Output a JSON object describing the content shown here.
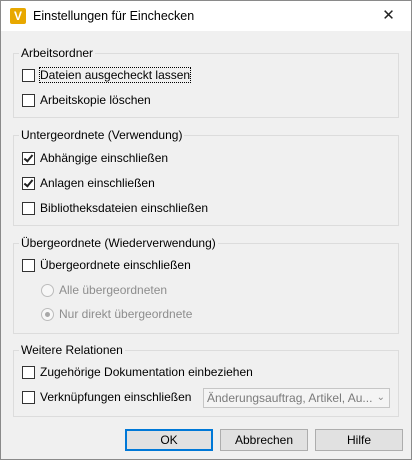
{
  "window": {
    "title": "Einstellungen für Einchecken",
    "icon_letter": "V",
    "close_glyph": "✕"
  },
  "groups": {
    "work_folder": {
      "title": "Arbeitsordner",
      "keep_checked_out": {
        "label": "Dateien ausgecheckt lassen",
        "checked": false
      },
      "delete_working_copy": {
        "label": "Arbeitskopie löschen",
        "checked": false
      }
    },
    "children": {
      "title": "Untergeordnete (Verwendung)",
      "include_dependents": {
        "label": "Abhängige einschließen",
        "checked": true
      },
      "include_attachments": {
        "label": "Anlagen einschließen",
        "checked": true
      },
      "include_library": {
        "label": "Bibliotheksdateien einschließen",
        "checked": false
      }
    },
    "parents": {
      "title": "Übergeordnete (Wiederverwendung)",
      "include_parents": {
        "label": "Übergeordnete einschließen",
        "checked": false
      },
      "all_parents": {
        "label": "Alle übergeordneten",
        "selected": false
      },
      "direct_parents": {
        "label": "Nur direkt übergeordnete",
        "selected": true
      }
    },
    "relations": {
      "title": "Weitere Relationen",
      "include_docs": {
        "label": "Zugehörige Dokumentation einbeziehen",
        "checked": false
      },
      "include_links": {
        "label": "Verknüpfungen einschließen",
        "checked": false
      },
      "links_select_value": "Änderungsauftrag, Artikel, Au..."
    }
  },
  "buttons": {
    "ok": "OK",
    "cancel": "Abbrechen",
    "help": "Hilfe"
  },
  "colors": {
    "accent": "#0078d7",
    "app_icon": "#e8a800"
  }
}
